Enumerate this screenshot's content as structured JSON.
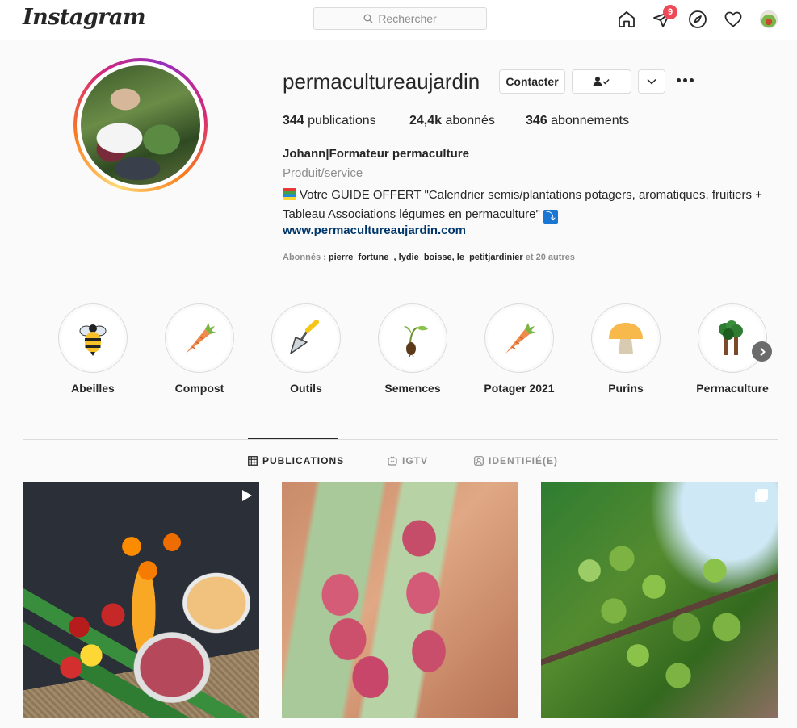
{
  "nav": {
    "logo": "Instagram",
    "search_placeholder": "Rechercher",
    "notification_count": "9",
    "icons": [
      "home-icon",
      "direct-icon",
      "explore-icon",
      "activity-icon",
      "avatar"
    ]
  },
  "profile": {
    "username": "permacultureaujardin",
    "buttons": {
      "contact": "Contacter"
    },
    "stats": [
      {
        "value": "344",
        "label": "publications"
      },
      {
        "value": "24,4k",
        "label": "abonnés"
      },
      {
        "value": "346",
        "label": "abonnements"
      }
    ],
    "full_name": "Johann|Formateur permaculture",
    "category": "Produit/service",
    "bio": "Votre GUIDE OFFERT \"Calendrier semis/plantations potagers, aromatiques, fruitiers + Tableau Associations légumes en permaculture\"",
    "website": "www.permacultureaujardin.com",
    "followed_by": {
      "prefix": "Abonnés :",
      "users": "pierre_fortune_, lydie_boisse, le_petitjardinier",
      "suffix": "et 20 autres"
    }
  },
  "highlights": [
    {
      "label": "Abeilles",
      "icon": "bee-icon"
    },
    {
      "label": "Compost",
      "icon": "carrot-icon"
    },
    {
      "label": "Outils",
      "icon": "trowel-icon"
    },
    {
      "label": "Semences",
      "icon": "seed-icon"
    },
    {
      "label": "Potager 2021",
      "icon": "carrot-icon"
    },
    {
      "label": "Purins",
      "icon": "mushroom-icon"
    },
    {
      "label": "Permaculture",
      "icon": "trees-icon"
    }
  ],
  "tabs": [
    {
      "label": "PUBLICATIONS",
      "active": true
    },
    {
      "label": "IGTV",
      "active": false
    },
    {
      "label": "IDENTIFIÉ(E)",
      "active": false
    }
  ],
  "posts": [
    {
      "subject": "vegetable crate",
      "overlay": "video-icon"
    },
    {
      "subject": "bean pods",
      "overlay": "none"
    },
    {
      "subject": "green fruit tree",
      "overlay": "carousel-icon"
    }
  ]
}
